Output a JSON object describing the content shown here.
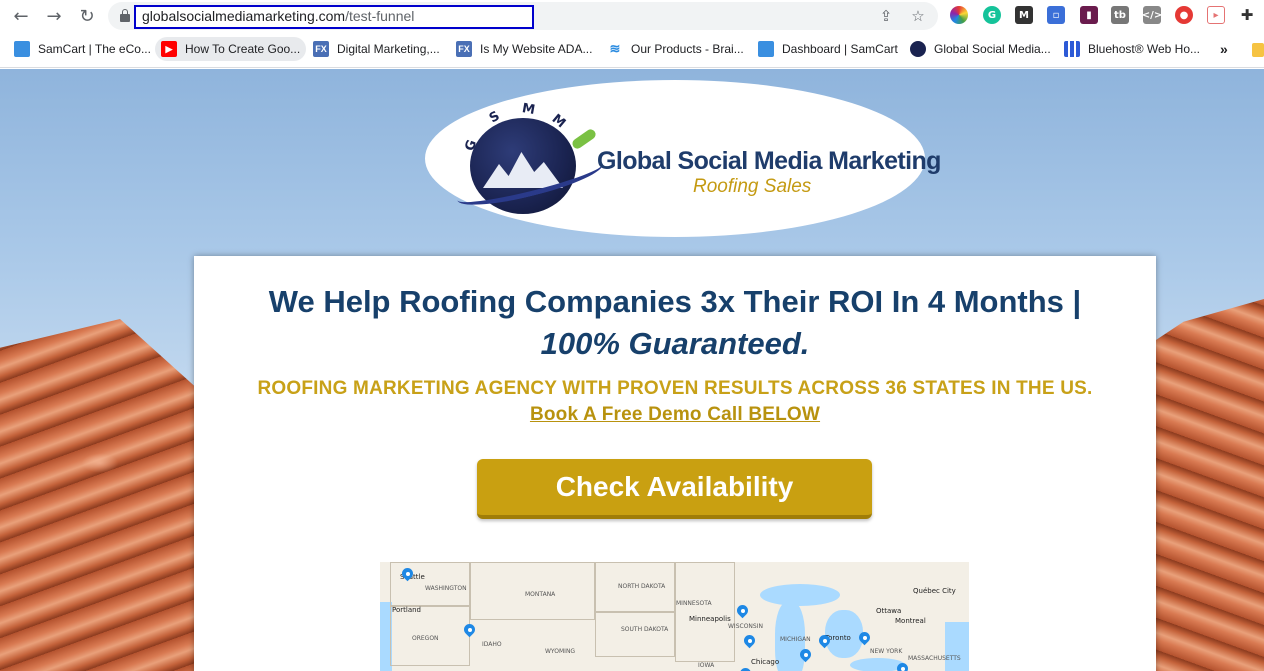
{
  "browser": {
    "url_host": "globalsocialmediamarketing.com",
    "url_path": "/test-funnel"
  },
  "bookmarks": [
    {
      "label": "SamCart | The eCo...",
      "icon": "samcart-icon",
      "color": "#3a8fe0"
    },
    {
      "label": "How To Create Goo...",
      "icon": "youtube-icon",
      "color": "#ff0000"
    },
    {
      "label": "Digital Marketing,...",
      "icon": "fx-icon",
      "color": "#4a6fb5"
    },
    {
      "label": "Is My Website ADA...",
      "icon": "fx-icon",
      "color": "#4a6fb5"
    },
    {
      "label": "Our Products - Brai...",
      "icon": "wifi-icon",
      "color": "#2a8be0"
    },
    {
      "label": "Dashboard | SamCart",
      "icon": "samcart-icon",
      "color": "#3a8fe0"
    },
    {
      "label": "Global Social Media...",
      "icon": "gsmm-icon",
      "color": "#1a2350"
    },
    {
      "label": "Bluehost® Web Ho...",
      "icon": "bluehost-icon",
      "color": "#2d5ad6"
    }
  ],
  "logo": {
    "letters": [
      "G",
      "S",
      "M",
      "M"
    ],
    "title": "Global Social Media Marketing",
    "subtitle": "Roofing Sales"
  },
  "hero": {
    "headline": "We Help Roofing Companies 3x Their ROI In 4 Months |",
    "headline_emphasis": "100% Guaranteed.",
    "subhead": "ROOFING MARKETING AGENCY WITH PROVEN RESULTS ACROSS 36 STATES IN THE US.",
    "subhead_link": "Book A Free Demo Call BELOW",
    "cta_label": "Check Availability"
  },
  "map": {
    "state_labels": [
      "WASHINGTON",
      "MONTANA",
      "NORTH DAKOTA",
      "MINNESOTA",
      "OREGON",
      "IDAHO",
      "SOUTH DAKOTA",
      "WISCONSIN",
      "MICHIGAN",
      "WYOMING",
      "IOWA",
      "NEW YORK",
      "MASSACHUSETTS"
    ],
    "city_labels": [
      "Portland",
      "Minneapolis",
      "Chicago",
      "Toronto",
      "Ottawa",
      "Montreal",
      "Québec City",
      "Seattle"
    ]
  },
  "colors": {
    "headline": "#17406b",
    "gold": "#c8a118",
    "cta_bg": "#c9a011",
    "url_highlight": "#0000cc"
  }
}
